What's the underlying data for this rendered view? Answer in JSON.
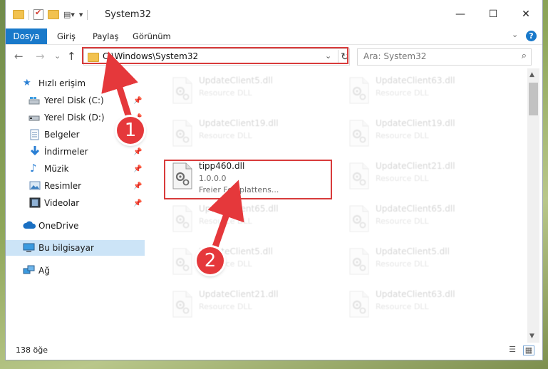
{
  "window": {
    "title": "System32",
    "controls": {
      "minimize": "—",
      "maximize": "☐",
      "close": "✕"
    }
  },
  "ribbon": {
    "file_tab": "Dosya",
    "tabs": [
      "Giriş",
      "Paylaş",
      "Görünüm"
    ],
    "help": "?"
  },
  "navigation": {
    "back": "←",
    "forward": "→",
    "recent": "⌄",
    "up": "↑",
    "address": "C:\\Windows\\System32",
    "address_dropdown": "⌄",
    "refresh": "↻",
    "search_placeholder": "Ara: System32",
    "search_icon": "⌕"
  },
  "sidebar": {
    "quick_access": "Hızlı erişim",
    "items": [
      {
        "label": "Yerel Disk (C:)",
        "icon": "drive-icon",
        "pinned": true
      },
      {
        "label": "Yerel Disk (D:)",
        "icon": "drive-icon",
        "pinned": true
      },
      {
        "label": "Belgeler",
        "icon": "documents-icon",
        "pinned": true
      },
      {
        "label": "İndirmeler",
        "icon": "downloads-icon",
        "pinned": true
      },
      {
        "label": "Müzik",
        "icon": "music-icon",
        "pinned": true
      },
      {
        "label": "Resimler",
        "icon": "pictures-icon",
        "pinned": true
      },
      {
        "label": "Videolar",
        "icon": "videos-icon",
        "pinned": true
      }
    ],
    "onedrive": "OneDrive",
    "this_pc": "Bu bilgisayar",
    "network": "Ağ"
  },
  "files": {
    "left": [
      {
        "name": "UpdateClient5.dll",
        "desc": "Resource DLL"
      },
      {
        "name": "UpdateClient19.dll",
        "desc": "Resource DLL"
      },
      {
        "name": "tipp460.dll",
        "desc": "1.0.0.0",
        "desc2": "Freier Festplattens..."
      },
      {
        "name": "UpdateClient65.dll",
        "desc": "Resource DLL"
      },
      {
        "name": "UpdateClient5.dll",
        "desc": "Resource DLL"
      },
      {
        "name": "UpdateClient21.dll",
        "desc": "Resource DLL"
      }
    ],
    "right": [
      {
        "name": "UpdateClient63.dll",
        "desc": "Resource DLL"
      },
      {
        "name": "UpdateClient19.dll",
        "desc": "Resource DLL"
      },
      {
        "name": "UpdateClient21.dll",
        "desc": "Resource DLL"
      },
      {
        "name": "UpdateClient65.dll",
        "desc": "Resource DLL"
      },
      {
        "name": "UpdateClient5.dll",
        "desc": "Resource DLL"
      },
      {
        "name": "UpdateClient63.dll",
        "desc": "Resource DLL"
      }
    ]
  },
  "status": {
    "count": "138 öğe"
  },
  "annotations": {
    "step1": "1",
    "step2": "2",
    "color": "#e5383b"
  }
}
